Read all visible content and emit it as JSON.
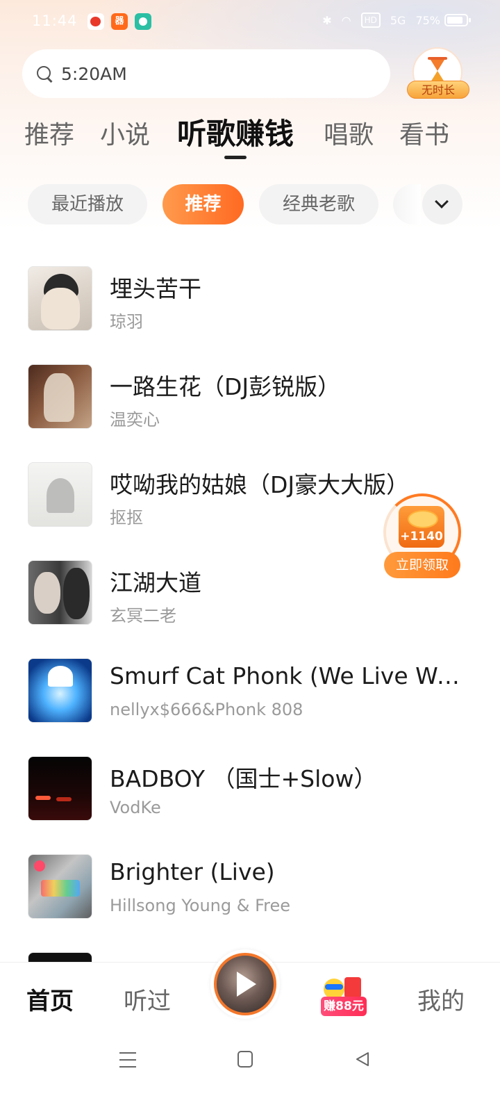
{
  "status_bar": {
    "time": "11:44",
    "app_badge": "器",
    "hd": "HD",
    "network": "5G",
    "battery": "75%"
  },
  "search": {
    "value": "5:20AM"
  },
  "timer_badge": {
    "label": "无时长"
  },
  "main_tabs": [
    {
      "label": "推荐",
      "active": false
    },
    {
      "label": "小说",
      "active": false
    },
    {
      "label": "听歌赚钱",
      "active": true
    },
    {
      "label": "唱歌",
      "active": false
    },
    {
      "label": "看书",
      "active": false
    }
  ],
  "chips": [
    {
      "label": "最近播放",
      "active": false
    },
    {
      "label": "推荐",
      "active": true
    },
    {
      "label": "经典老歌",
      "active": false
    }
  ],
  "songs": [
    {
      "title": "埋头苦干",
      "artist": "琼羽"
    },
    {
      "title": "一路生花（DJ彭锐版）",
      "artist": "温奕心"
    },
    {
      "title": "哎呦我的姑娘（DJ豪大大版）",
      "artist": "抠抠"
    },
    {
      "title": "江湖大道",
      "artist": "玄冥二老"
    },
    {
      "title": "Smurf Cat Phonk (We Live We ...",
      "artist": "nellyx$666&Phonk 808"
    },
    {
      "title": "BADBOY （国士+Slow）",
      "artist": "VodKe"
    },
    {
      "title": "Brighter (Live)",
      "artist": "Hillsong Young & Free"
    }
  ],
  "reward": {
    "amount": "+1140",
    "button": "立即领取"
  },
  "bottom_nav": {
    "home": "首页",
    "history": "听过",
    "earn": "赚88元",
    "mine": "我的"
  }
}
